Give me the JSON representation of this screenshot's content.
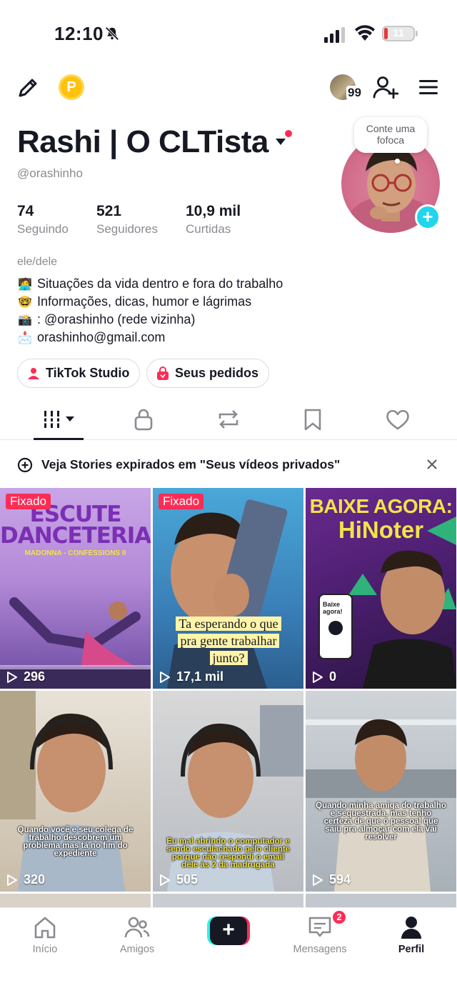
{
  "status_bar": {
    "time": "12:10",
    "battery": "11",
    "battery_level": 0.11
  },
  "top_nav": {
    "coin_letter": "P",
    "friends_count": "99",
    "icons": [
      "edit-icon",
      "coin-icon",
      "add-friend-icon",
      "menu-icon"
    ]
  },
  "profile": {
    "name": "Rashi | O CLTista",
    "username": "@orashinho",
    "bubble_text": "Conte uma fofoca",
    "stats": [
      {
        "value": "74",
        "label": "Seguindo"
      },
      {
        "value": "521",
        "label": "Seguidores"
      },
      {
        "value": "10,9 mil",
        "label": "Curtidas"
      }
    ],
    "pronouns": "ele/dele",
    "bio": [
      {
        "emoji": "🧑‍💻",
        "text": "Situações da vida dentro e fora do trabalho"
      },
      {
        "emoji": "🤓",
        "text": "Informações, dicas, humor e lágrimas"
      },
      {
        "emoji": "📸",
        "text": ": @orashinho (rede vizinha)"
      },
      {
        "emoji": "📩",
        "text": "orashinho@gmail.com"
      }
    ],
    "buttons": {
      "studio": "TikTok Studio",
      "orders": "Seus pedidos"
    }
  },
  "tabs": [
    "videos",
    "private",
    "reposts",
    "favorites",
    "liked"
  ],
  "notice": {
    "text": "Veja Stories expirados em \"Seus vídeos privados\""
  },
  "videos": [
    {
      "pinned": "Fixado",
      "views": "296",
      "title": "ESCUTE DANCETERIA",
      "subtitle": "MADONNA - CONFESSIONS II"
    },
    {
      "pinned": "Fixado",
      "views": "17,1 mil",
      "caption": "Ta esperando o que pra gente trabalhar junto?"
    },
    {
      "views": "0",
      "title_a": "BAIXE AGORA:",
      "title_b": "HiNoter",
      "phone_text": "Baixe agora!"
    },
    {
      "views": "320",
      "caption": "Quando você e seu colega de trabalho descobrem um problema mas tá no fim do expediente"
    },
    {
      "views": "505",
      "caption": "Eu mal abrindo o computador e sendo esculachado pelo cliente porque não respondi o email dele às 2 da madrugada"
    },
    {
      "views": "594",
      "caption": "Quando minha amiga do trabalho e sequestrada, mas tenho certeza de que o pessoal que saiu pra almoçar com ela vai resolver"
    }
  ],
  "bottom_nav": {
    "home": "Início",
    "friends": "Amigos",
    "messages": "Mensagens",
    "messages_badge": "2",
    "profile": "Perfil"
  },
  "colors": {
    "accent": "#fe2c55",
    "cyan": "#25f4ee",
    "text": "#161823",
    "muted": "#8a8b91"
  }
}
